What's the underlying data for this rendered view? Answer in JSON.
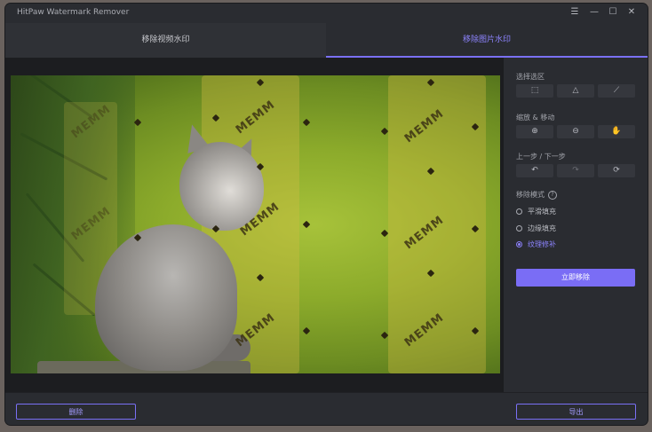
{
  "window": {
    "title": "HitPaw Watermark Remover"
  },
  "controls": {
    "menu_icon": "☰",
    "minimize_icon": "—",
    "maximize_icon": "☐",
    "close_icon": "✕"
  },
  "tabs": [
    {
      "label": "移除视频水印",
      "active": false
    },
    {
      "label": "移除图片水印",
      "active": true
    }
  ],
  "canvas": {
    "watermark_text": "MEMM"
  },
  "panel": {
    "selection": {
      "title": "选择选区",
      "tools": [
        {
          "name": "rectangle-select-icon",
          "glyph": "⬚"
        },
        {
          "name": "polygon-select-icon",
          "glyph": "△"
        },
        {
          "name": "brush-select-icon",
          "glyph": "⟋"
        }
      ]
    },
    "zoom": {
      "title": "缩放 & 移动",
      "tools": [
        {
          "name": "zoom-in-icon",
          "glyph": "⊕"
        },
        {
          "name": "zoom-out-icon",
          "glyph": "⊖"
        },
        {
          "name": "hand-icon",
          "glyph": "✋"
        }
      ]
    },
    "history": {
      "title": "上一步 / 下一步",
      "tools": [
        {
          "name": "undo-icon",
          "glyph": "↶"
        },
        {
          "name": "redo-icon",
          "glyph": "↷"
        },
        {
          "name": "reset-icon",
          "glyph": "⟳"
        }
      ]
    },
    "mode": {
      "title": "移除模式",
      "info_icon": "?",
      "options": [
        {
          "label": "平滑填充",
          "selected": false
        },
        {
          "label": "边缘填充",
          "selected": false
        },
        {
          "label": "纹理修补",
          "selected": true
        }
      ]
    },
    "remove_button": "立即移除"
  },
  "footer": {
    "left_button": "删除",
    "right_button": "导出"
  },
  "colors": {
    "accent": "#7a6df5",
    "background": "#2a2c31",
    "canvas": "#1c1d20"
  }
}
